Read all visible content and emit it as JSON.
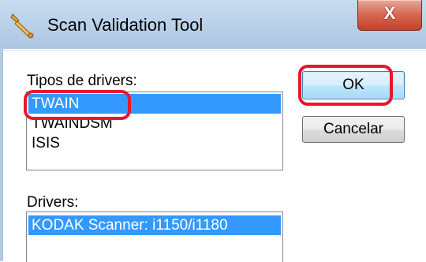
{
  "window": {
    "title": "Scan Validation Tool",
    "app_icon": "wrench-icon",
    "close_label": "X"
  },
  "driver_types": {
    "label": "Tipos de drivers:",
    "items": [
      "TWAIN",
      "TWAINDSM",
      "ISIS"
    ],
    "selected": "TWAIN"
  },
  "drivers": {
    "label": "Drivers:",
    "items": [
      "KODAK Scanner: i1150/i1180"
    ],
    "selected": "KODAK Scanner: i1150/i1180"
  },
  "buttons": {
    "ok_label": "OK",
    "cancel_label": "Cancelar"
  },
  "colors": {
    "selection": "#3399ff",
    "highlight_annotation": "#e8182b",
    "titlebar": "#bcd2ea"
  }
}
